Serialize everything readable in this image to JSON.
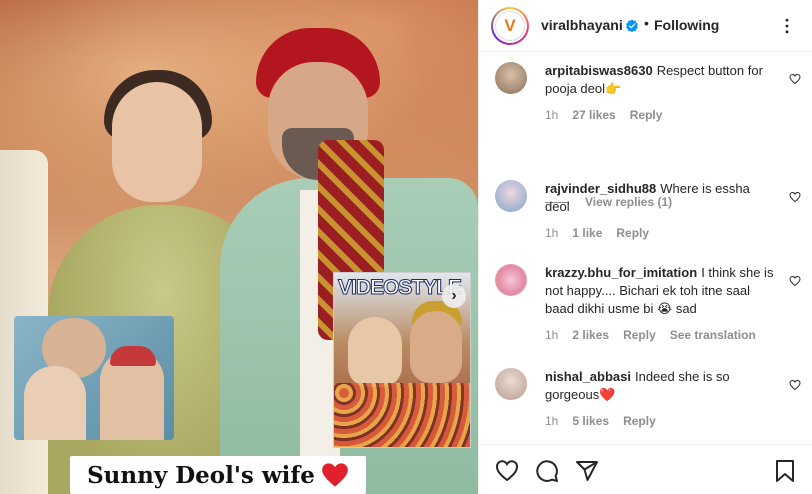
{
  "media": {
    "caption": "Sunny Deol's wife",
    "magazine_title": "VIDEOSTYLE",
    "icons": {
      "next": "chevron-right-icon",
      "heart": "red-heart-emoji"
    }
  },
  "header": {
    "username": "viralbhayani",
    "separator": "•",
    "follow_status": "Following",
    "avatar_letter": "V",
    "icons": {
      "verified": "verified-badge-icon",
      "more": "more-options-icon"
    }
  },
  "comments": [
    {
      "username": "arpitabiswas8630",
      "text": "Respect button for pooja deol👉",
      "time": "1h",
      "likes": "27 likes",
      "reply": "Reply",
      "view_replies": "View replies (1)"
    },
    {
      "username": "rajvinder_sidhu88",
      "text": "Where is essha deol",
      "time": "1h",
      "likes": "1 like",
      "reply": "Reply"
    },
    {
      "username": "krazzy.bhu_for_imitation",
      "text": "I think she is not happy.... Bichari ek toh itne saal baad dikhi usme bi 😭 sad",
      "time": "1h",
      "likes": "2 likes",
      "reply": "Reply",
      "translate": "See translation"
    },
    {
      "username": "nishal_abbasi",
      "text": "Indeed she is so gorgeous❤️",
      "time": "1h",
      "likes": "5 likes",
      "reply": "Reply"
    }
  ],
  "actions": {
    "icons": [
      "heart-outline-icon",
      "comment-icon",
      "share-icon",
      "bookmark-icon"
    ]
  },
  "colors": {
    "verified_blue": "#0095f6",
    "heart_red": "#ed4956",
    "text_primary": "#262626",
    "text_secondary": "#8e8e8e"
  }
}
